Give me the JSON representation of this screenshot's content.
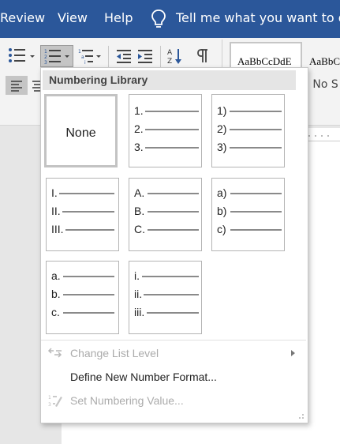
{
  "menubar": {
    "items": [
      "Review",
      "View",
      "Help"
    ],
    "tell_me": "Tell me what you want to do"
  },
  "ribbon": {
    "style_samples": [
      "AaBbCcDdE",
      "AaBbC"
    ],
    "style_name_partial": "¶ No S"
  },
  "dropdown": {
    "header": "Numbering Library",
    "tiles": [
      {
        "type": "none",
        "label": "None",
        "selected": true
      },
      {
        "type": "list",
        "labels": [
          "1.",
          "2.",
          "3."
        ]
      },
      {
        "type": "list",
        "labels": [
          "1)",
          "2)",
          "3)"
        ]
      },
      {
        "type": "list",
        "labels": [
          "I.",
          "II.",
          "III."
        ]
      },
      {
        "type": "list",
        "labels": [
          "A.",
          "B.",
          "C."
        ]
      },
      {
        "type": "list",
        "labels": [
          "a)",
          "b)",
          "c)"
        ]
      },
      {
        "type": "list",
        "labels": [
          "a.",
          "b.",
          "c."
        ]
      },
      {
        "type": "list",
        "labels": [
          "i.",
          "ii.",
          "iii."
        ]
      }
    ],
    "menu": {
      "change_level": "Change List Level",
      "define_format": "Define New Number Format...",
      "set_value": "Set Numbering Value..."
    }
  },
  "colors": {
    "title_bar": "#2b579a",
    "ribbon": "#f3f3f3",
    "disabled_text": "#ababab"
  }
}
